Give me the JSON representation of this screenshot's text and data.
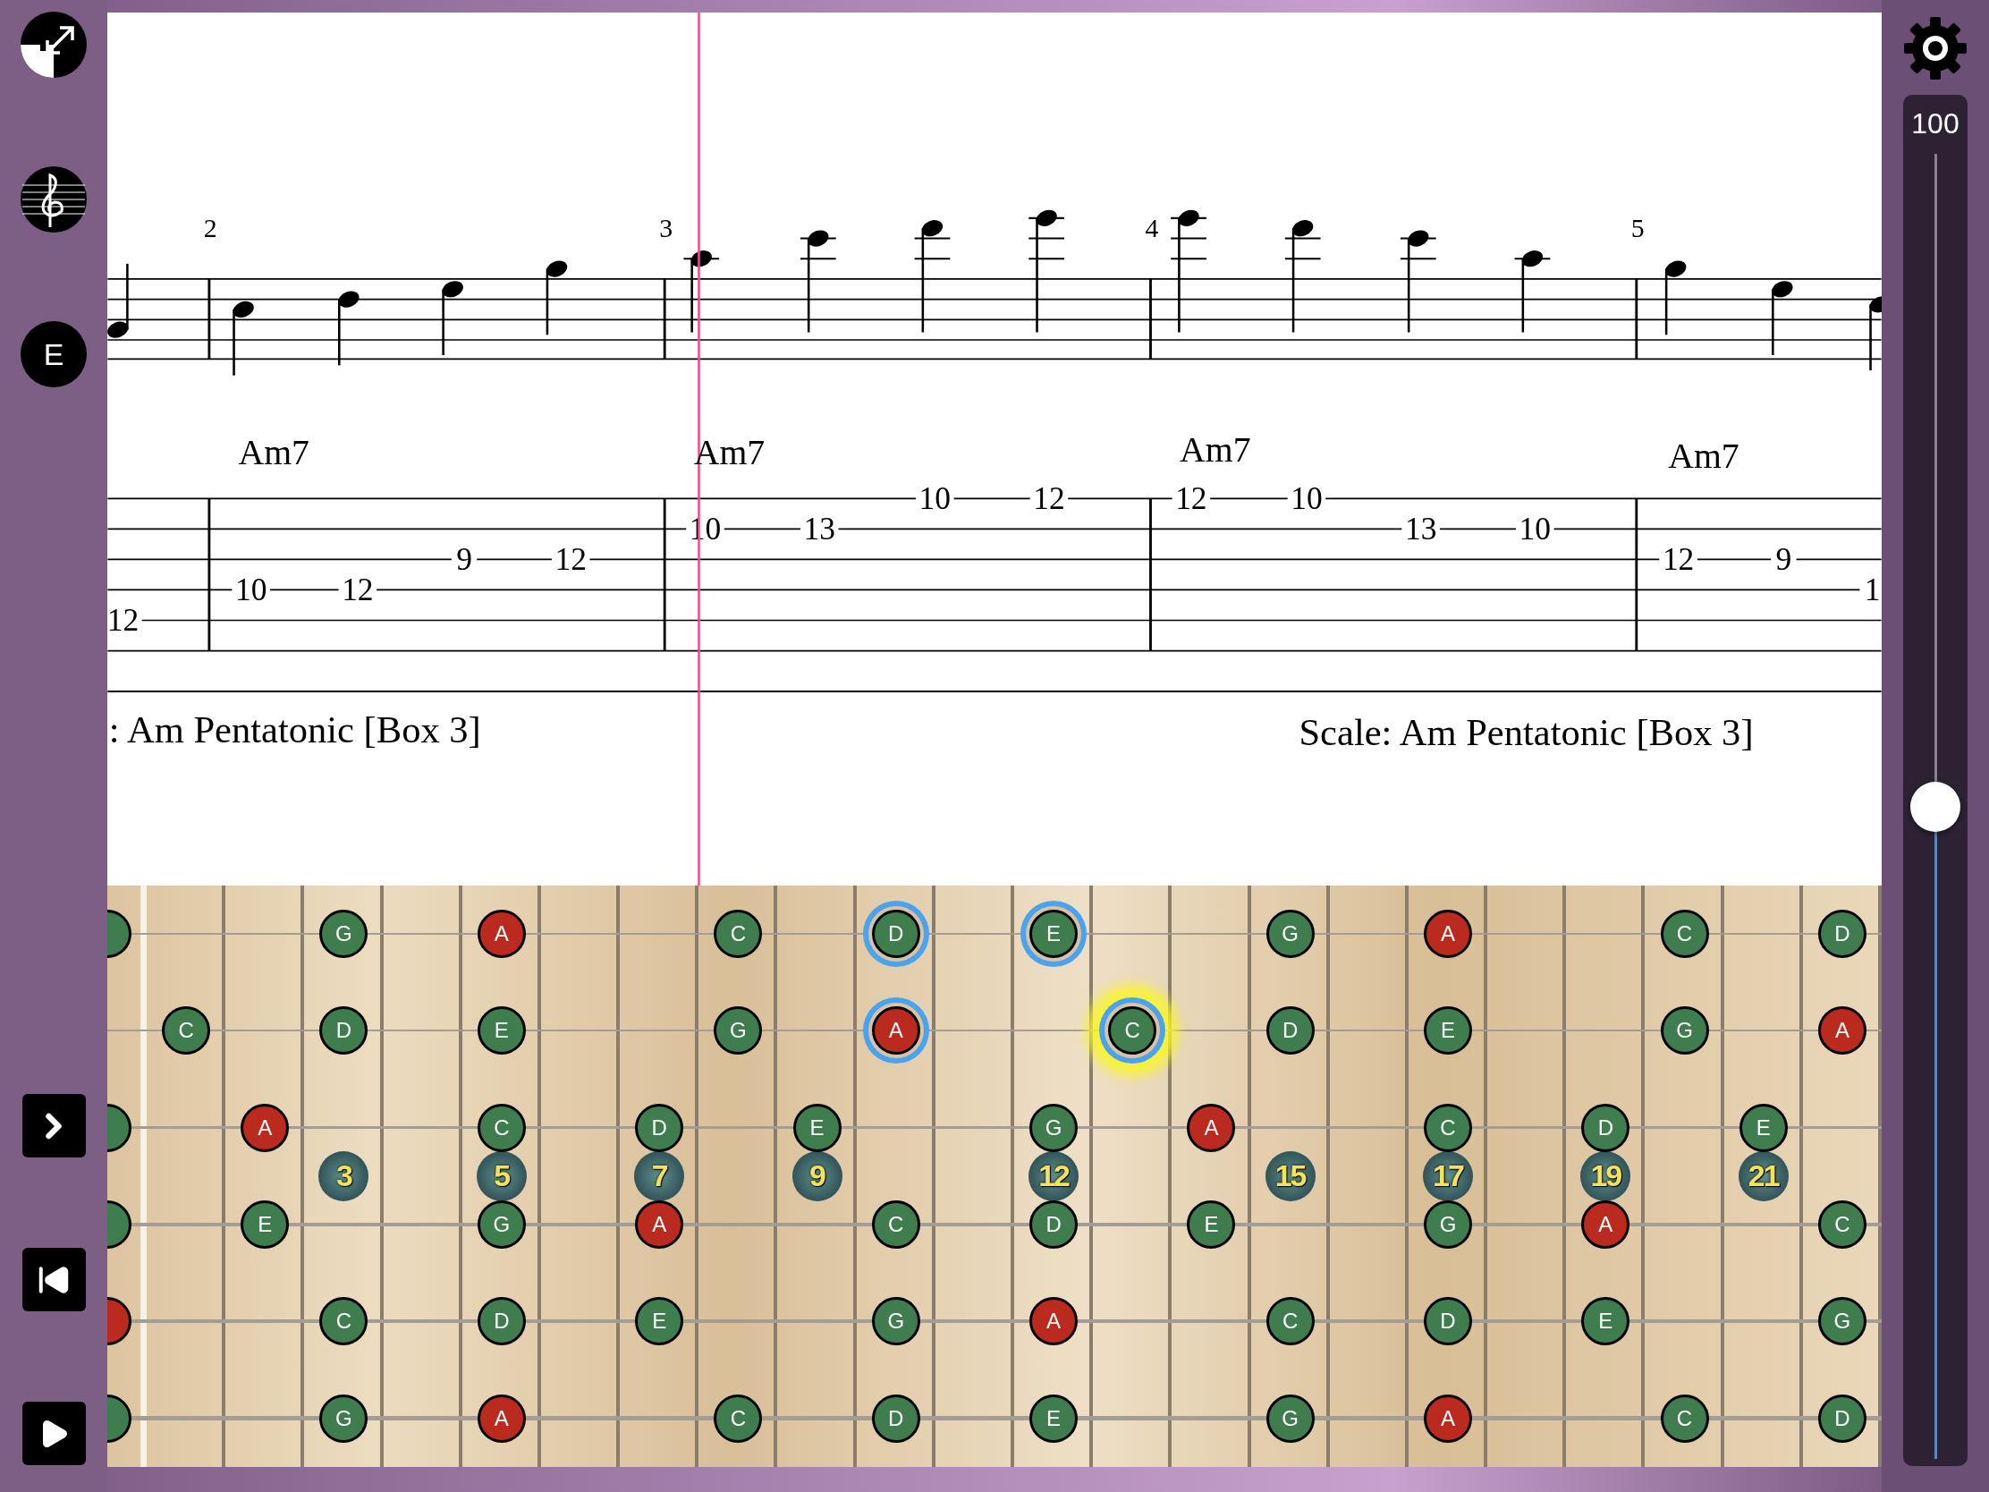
{
  "sidebar": {
    "key_button": {
      "label": "E"
    }
  },
  "score": {
    "measures": [
      {
        "notes": [
          {
            "tab": "12",
            "kind": "a"
          }
        ]
      },
      {
        "number": "2",
        "chord": "Am7",
        "notes": [
          {
            "tab": "10",
            "kind": "d"
          },
          {
            "tab": "12",
            "kind": "d"
          },
          {
            "tab": "9",
            "kind": "g"
          },
          {
            "tab": "12",
            "kind": "g"
          }
        ]
      },
      {
        "number": "3",
        "chord": "Am7",
        "notes": [
          {
            "tab": "10",
            "kind": "b"
          },
          {
            "tab": "13",
            "kind": "b"
          },
          {
            "tab": "10",
            "kind": "treble"
          },
          {
            "tab": "12",
            "kind": "treble"
          }
        ]
      },
      {
        "number": "4",
        "chord": "Am7",
        "notes": [
          {
            "tab": "12",
            "kind": "treble"
          },
          {
            "tab": "10",
            "kind": "treble"
          },
          {
            "tab": "13",
            "kind": "b"
          },
          {
            "tab": "10",
            "kind": "b"
          }
        ]
      },
      {
        "number": "5",
        "chord": "Am7",
        "notes": [
          {
            "tab": "12",
            "kind": "g"
          },
          {
            "tab": "9",
            "kind": "g"
          },
          {
            "tab": "1",
            "kind": "d"
          }
        ]
      }
    ],
    "scale_labels": [
      ": Am Pentatonic [Box 3]",
      "Scale: Am Pentatonic [Box 3]"
    ]
  },
  "fretboard": {
    "strings": [
      {
        "slots": [
          {
            "kind": "open",
            "root": false,
            "highlighted": false,
            "playing": false
          },
          {
            "kind": "empty"
          },
          {
            "kind": "empty"
          },
          {
            "kind": "note",
            "note": "G",
            "root": false,
            "highlighted": false,
            "playing": false
          },
          {
            "kind": "empty"
          },
          {
            "kind": "note",
            "note": "A",
            "root": true,
            "highlighted": false,
            "playing": false
          },
          {
            "kind": "empty"
          },
          {
            "kind": "empty"
          },
          {
            "kind": "note",
            "note": "C",
            "root": false,
            "highlighted": false,
            "playing": false
          },
          {
            "kind": "empty"
          },
          {
            "kind": "note",
            "note": "D",
            "root": false,
            "highlighted": true,
            "playing": false
          },
          {
            "kind": "empty"
          },
          {
            "kind": "note",
            "note": "E",
            "root": false,
            "highlighted": true,
            "playing": false
          },
          {
            "kind": "empty"
          },
          {
            "kind": "empty"
          },
          {
            "kind": "note",
            "note": "G",
            "root": false,
            "highlighted": false,
            "playing": false
          },
          {
            "kind": "empty"
          },
          {
            "kind": "note",
            "note": "A",
            "root": true,
            "highlighted": false,
            "playing": false
          },
          {
            "kind": "empty"
          },
          {
            "kind": "empty"
          },
          {
            "kind": "note",
            "note": "C",
            "root": false,
            "highlighted": false,
            "playing": false
          },
          {
            "kind": "empty"
          },
          {
            "kind": "note",
            "note": "D",
            "root": false,
            "highlighted": false,
            "playing": false
          }
        ]
      },
      {
        "slots": [
          {
            "kind": "empty"
          },
          {
            "kind": "note",
            "note": "C",
            "root": false,
            "highlighted": false,
            "playing": false
          },
          {
            "kind": "empty"
          },
          {
            "kind": "note",
            "note": "D",
            "root": false,
            "highlighted": false,
            "playing": false
          },
          {
            "kind": "empty"
          },
          {
            "kind": "note",
            "note": "E",
            "root": false,
            "highlighted": false,
            "playing": false
          },
          {
            "kind": "empty"
          },
          {
            "kind": "empty"
          },
          {
            "kind": "note",
            "note": "G",
            "root": false,
            "highlighted": false,
            "playing": false
          },
          {
            "kind": "empty"
          },
          {
            "kind": "note",
            "note": "A",
            "root": true,
            "highlighted": true,
            "playing": false
          },
          {
            "kind": "empty"
          },
          {
            "kind": "empty"
          },
          {
            "kind": "note",
            "note": "C",
            "root": false,
            "highlighted": true,
            "playing": true
          },
          {
            "kind": "empty"
          },
          {
            "kind": "note",
            "note": "D",
            "root": false,
            "highlighted": false,
            "playing": false
          },
          {
            "kind": "empty"
          },
          {
            "kind": "note",
            "note": "E",
            "root": false,
            "highlighted": false,
            "playing": false
          },
          {
            "kind": "empty"
          },
          {
            "kind": "empty"
          },
          {
            "kind": "note",
            "note": "G",
            "root": false,
            "highlighted": false,
            "playing": false
          },
          {
            "kind": "empty"
          },
          {
            "kind": "note",
            "note": "A",
            "root": true,
            "highlighted": false,
            "playing": false
          }
        ]
      },
      {
        "slots": [
          {
            "kind": "open",
            "root": false,
            "highlighted": false,
            "playing": false
          },
          {
            "kind": "empty"
          },
          {
            "kind": "note",
            "note": "A",
            "root": true,
            "highlighted": false,
            "playing": false
          },
          {
            "kind": "empty"
          },
          {
            "kind": "empty"
          },
          {
            "kind": "note",
            "note": "C",
            "root": false,
            "highlighted": false,
            "playing": false
          },
          {
            "kind": "empty"
          },
          {
            "kind": "note",
            "note": "D",
            "root": false,
            "highlighted": false,
            "playing": false
          },
          {
            "kind": "empty"
          },
          {
            "kind": "note",
            "note": "E",
            "root": false,
            "highlighted": false,
            "playing": false
          },
          {
            "kind": "empty"
          },
          {
            "kind": "empty"
          },
          {
            "kind": "note",
            "note": "G",
            "root": false,
            "highlighted": false,
            "playing": false
          },
          {
            "kind": "empty"
          },
          {
            "kind": "note",
            "note": "A",
            "root": true,
            "highlighted": false,
            "playing": false
          },
          {
            "kind": "empty"
          },
          {
            "kind": "empty"
          },
          {
            "kind": "note",
            "note": "C",
            "root": false,
            "highlighted": false,
            "playing": false
          },
          {
            "kind": "empty"
          },
          {
            "kind": "note",
            "note": "D",
            "root": false,
            "highlighted": false,
            "playing": false
          },
          {
            "kind": "empty"
          },
          {
            "kind": "note",
            "note": "E",
            "root": false,
            "highlighted": false,
            "playing": false
          }
        ]
      },
      {
        "slots": [
          {
            "kind": "open",
            "root": false,
            "highlighted": false,
            "playing": false
          },
          {
            "kind": "empty"
          },
          {
            "kind": "note",
            "note": "E",
            "root": false,
            "highlighted": false,
            "playing": false
          },
          {
            "kind": "empty"
          },
          {
            "kind": "empty"
          },
          {
            "kind": "note",
            "note": "G",
            "root": false,
            "highlighted": false,
            "playing": false
          },
          {
            "kind": "empty"
          },
          {
            "kind": "note",
            "note": "A",
            "root": true,
            "highlighted": false,
            "playing": false
          },
          {
            "kind": "empty"
          },
          {
            "kind": "empty"
          },
          {
            "kind": "note",
            "note": "C",
            "root": false,
            "highlighted": false,
            "playing": false
          },
          {
            "kind": "empty"
          },
          {
            "kind": "note",
            "note": "D",
            "root": false,
            "highlighted": false,
            "playing": false
          },
          {
            "kind": "empty"
          },
          {
            "kind": "note",
            "note": "E",
            "root": false,
            "highlighted": false,
            "playing": false
          },
          {
            "kind": "empty"
          },
          {
            "kind": "empty"
          },
          {
            "kind": "note",
            "note": "G",
            "root": false,
            "highlighted": false,
            "playing": false
          },
          {
            "kind": "empty"
          },
          {
            "kind": "note",
            "note": "A",
            "root": true,
            "highlighted": false,
            "playing": false
          },
          {
            "kind": "empty"
          },
          {
            "kind": "empty"
          },
          {
            "kind": "note",
            "note": "C",
            "root": false,
            "highlighted": false,
            "playing": false
          }
        ]
      },
      {
        "slots": [
          {
            "kind": "open",
            "root": true,
            "highlighted": false,
            "playing": false
          },
          {
            "kind": "empty"
          },
          {
            "kind": "empty"
          },
          {
            "kind": "note",
            "note": "C",
            "root": false,
            "highlighted": false,
            "playing": false
          },
          {
            "kind": "empty"
          },
          {
            "kind": "note",
            "note": "D",
            "root": false,
            "highlighted": false,
            "playing": false
          },
          {
            "kind": "empty"
          },
          {
            "kind": "note",
            "note": "E",
            "root": false,
            "highlighted": false,
            "playing": false
          },
          {
            "kind": "empty"
          },
          {
            "kind": "empty"
          },
          {
            "kind": "note",
            "note": "G",
            "root": false,
            "highlighted": false,
            "playing": false
          },
          {
            "kind": "empty"
          },
          {
            "kind": "note",
            "note": "A",
            "root": true,
            "highlighted": false,
            "playing": false
          },
          {
            "kind": "empty"
          },
          {
            "kind": "empty"
          },
          {
            "kind": "note",
            "note": "C",
            "root": false,
            "highlighted": false,
            "playing": false
          },
          {
            "kind": "empty"
          },
          {
            "kind": "note",
            "note": "D",
            "root": false,
            "highlighted": false,
            "playing": false
          },
          {
            "kind": "empty"
          },
          {
            "kind": "note",
            "note": "E",
            "root": false,
            "highlighted": false,
            "playing": false
          },
          {
            "kind": "empty"
          },
          {
            "kind": "empty"
          },
          {
            "kind": "note",
            "note": "G",
            "root": false,
            "highlighted": false,
            "playing": false
          }
        ]
      },
      {
        "slots": [
          {
            "kind": "open",
            "root": false,
            "highlighted": false,
            "playing": false
          },
          {
            "kind": "empty"
          },
          {
            "kind": "empty"
          },
          {
            "kind": "note",
            "note": "G",
            "root": false,
            "highlighted": false,
            "playing": false
          },
          {
            "kind": "empty"
          },
          {
            "kind": "note",
            "note": "A",
            "root": true,
            "highlighted": false,
            "playing": false
          },
          {
            "kind": "empty"
          },
          {
            "kind": "empty"
          },
          {
            "kind": "note",
            "note": "C",
            "root": false,
            "highlighted": false,
            "playing": false
          },
          {
            "kind": "empty"
          },
          {
            "kind": "note",
            "note": "D",
            "root": false,
            "highlighted": false,
            "playing": false
          },
          {
            "kind": "empty"
          },
          {
            "kind": "note",
            "note": "E",
            "root": false,
            "highlighted": false,
            "playing": false
          },
          {
            "kind": "empty"
          },
          {
            "kind": "empty"
          },
          {
            "kind": "note",
            "note": "G",
            "root": false,
            "highlighted": false,
            "playing": false
          },
          {
            "kind": "empty"
          },
          {
            "kind": "note",
            "note": "A",
            "root": true,
            "highlighted": false,
            "playing": false
          },
          {
            "kind": "empty"
          },
          {
            "kind": "empty"
          },
          {
            "kind": "note",
            "note": "C",
            "root": false,
            "highlighted": false,
            "playing": false
          },
          {
            "kind": "empty"
          },
          {
            "kind": "note",
            "note": "D",
            "root": false,
            "highlighted": false,
            "playing": false
          }
        ]
      }
    ],
    "marker_slots": [
      {
        "kind": "empty"
      },
      {
        "kind": "empty"
      },
      {
        "kind": "empty"
      },
      {
        "kind": "inlay",
        "label": "3"
      },
      {
        "kind": "empty"
      },
      {
        "kind": "inlay",
        "label": "5"
      },
      {
        "kind": "empty"
      },
      {
        "kind": "inlay",
        "label": "7"
      },
      {
        "kind": "empty"
      },
      {
        "kind": "inlay",
        "label": "9"
      },
      {
        "kind": "empty"
      },
      {
        "kind": "empty"
      },
      {
        "kind": "inlay",
        "label": "12"
      },
      {
        "kind": "empty"
      },
      {
        "kind": "empty"
      },
      {
        "kind": "inlay",
        "label": "15"
      },
      {
        "kind": "empty"
      },
      {
        "kind": "inlay",
        "label": "17"
      },
      {
        "kind": "empty"
      },
      {
        "kind": "inlay",
        "label": "19"
      },
      {
        "kind": "empty"
      },
      {
        "kind": "inlay",
        "label": "21"
      }
    ]
  },
  "volume": {
    "value": "100",
    "level": 0.5
  }
}
